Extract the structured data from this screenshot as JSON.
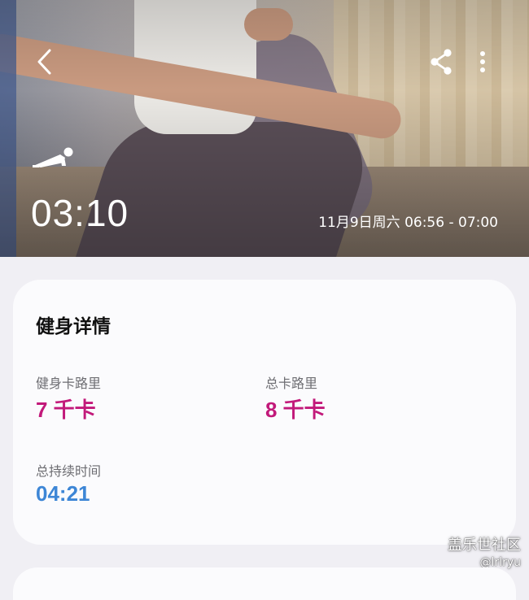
{
  "header": {
    "duration": "03:10",
    "time_range": "11月9日周六 06:56 - 07:00",
    "icons": [
      "back-icon",
      "share-icon",
      "more-icon",
      "plank-icon"
    ]
  },
  "details": {
    "title": "健身详情",
    "workout_calories": {
      "label": "健身卡路里",
      "value": "7 千卡"
    },
    "total_calories": {
      "label": "总卡路里",
      "value": "8 千卡"
    },
    "total_duration": {
      "label": "总持续时间",
      "value": "04:21"
    }
  },
  "watermark": {
    "logo": "盖乐世社区",
    "user": "@lrlryu"
  },
  "colors": {
    "calorie_value": "#c2197a",
    "duration_value": "#3d86d6",
    "background": "#f0eff4",
    "card": "#fbfbfd"
  }
}
